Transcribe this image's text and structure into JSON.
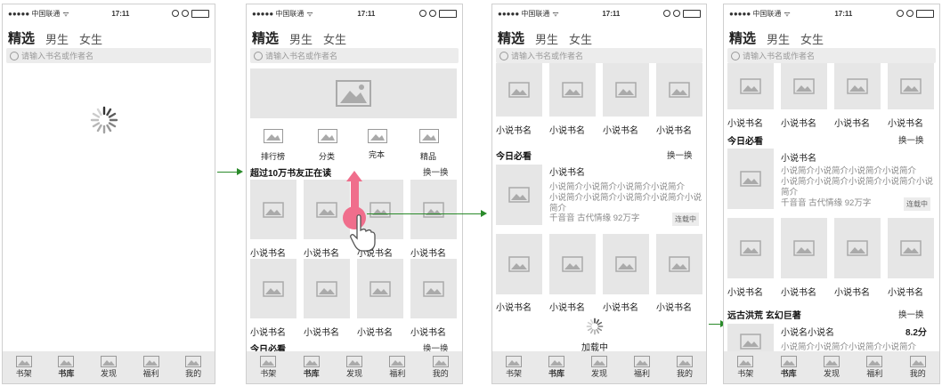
{
  "status": {
    "carrier": "●●●●● 中国联通",
    "time": "17:11"
  },
  "tabs": [
    "精选",
    "男生",
    "女生"
  ],
  "search_placeholder": "请输入书名或作者名",
  "nav": [
    "书架",
    "书库",
    "发现",
    "福利",
    "我的"
  ],
  "categories": [
    "排行榜",
    "分类",
    "完本",
    "精品"
  ],
  "section_readers": "超过10万书友正在读",
  "section_today": "今日必看",
  "section_fantasy": "远古洪荒 玄幻巨著",
  "swap": "换一换",
  "book_name": "小说书名",
  "book_name2": "小说名小说名",
  "intro_name": "小说书名",
  "intro_text1": "小说简介小说简介小说简介小说简介",
  "intro_text2": "小说简介小说简介小说简介小说简介",
  "intro_text3": "小说简介",
  "meta": "千音音 古代情缘 92万字",
  "badge": "连载中",
  "score": "8.2分",
  "loading": "加载中",
  "colors": {
    "accent_pink": "#f06e8c",
    "arrow_green": "#2a8a2a"
  }
}
